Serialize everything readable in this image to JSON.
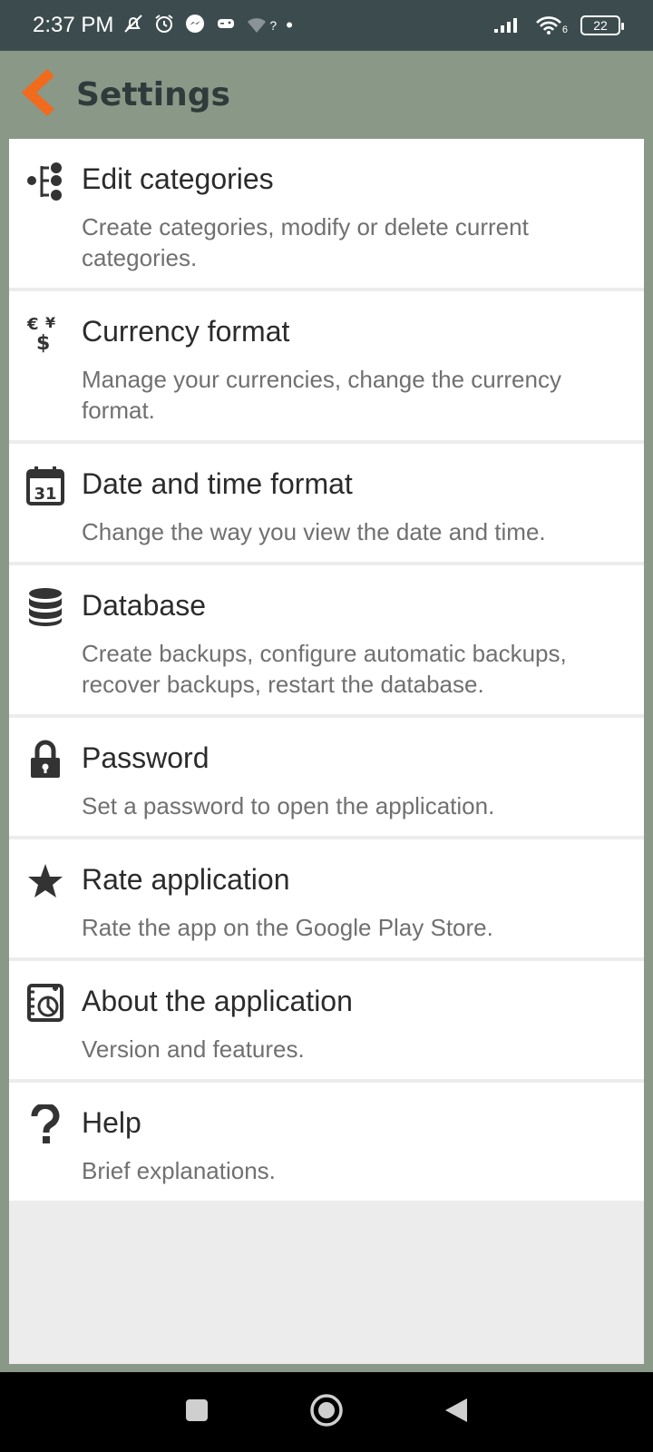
{
  "status_bar": {
    "time": "2:37 PM",
    "network_unknown": "?",
    "dot": "•",
    "wifi_sub": "6",
    "battery": "22"
  },
  "app_bar": {
    "title": "Settings",
    "back_icon": "chevron-left-icon",
    "accent_color": "#f26a1b"
  },
  "settings": [
    {
      "id": "edit-categories",
      "icon": "categories-tree-icon",
      "title": "Edit categories",
      "description": "Create categories, modify or delete current categories."
    },
    {
      "id": "currency-format",
      "icon": "currency-icon",
      "title": "Currency format",
      "description": "Manage your currencies, change the currency format."
    },
    {
      "id": "date-time-format",
      "icon": "calendar-icon",
      "calendar_day": "31",
      "title": "Date and time format",
      "description": "Change the way you view the date and time."
    },
    {
      "id": "database",
      "icon": "database-icon",
      "title": "Database",
      "description": "Create backups, configure automatic backups, recover backups, restart the database."
    },
    {
      "id": "password",
      "icon": "lock-icon",
      "title": "Password",
      "description": "Set a password to open the application."
    },
    {
      "id": "rate-application",
      "icon": "star-icon",
      "title": "Rate application",
      "description": "Rate the app on the Google Play Store."
    },
    {
      "id": "about-application",
      "icon": "about-chart-icon",
      "title": "About the application",
      "description": "Version and features."
    },
    {
      "id": "help",
      "icon": "question-icon",
      "title": "Help",
      "description": "Brief explanations."
    }
  ],
  "nav_bar": {
    "buttons": [
      "recents-icon",
      "home-icon",
      "back-triangle-icon"
    ]
  }
}
